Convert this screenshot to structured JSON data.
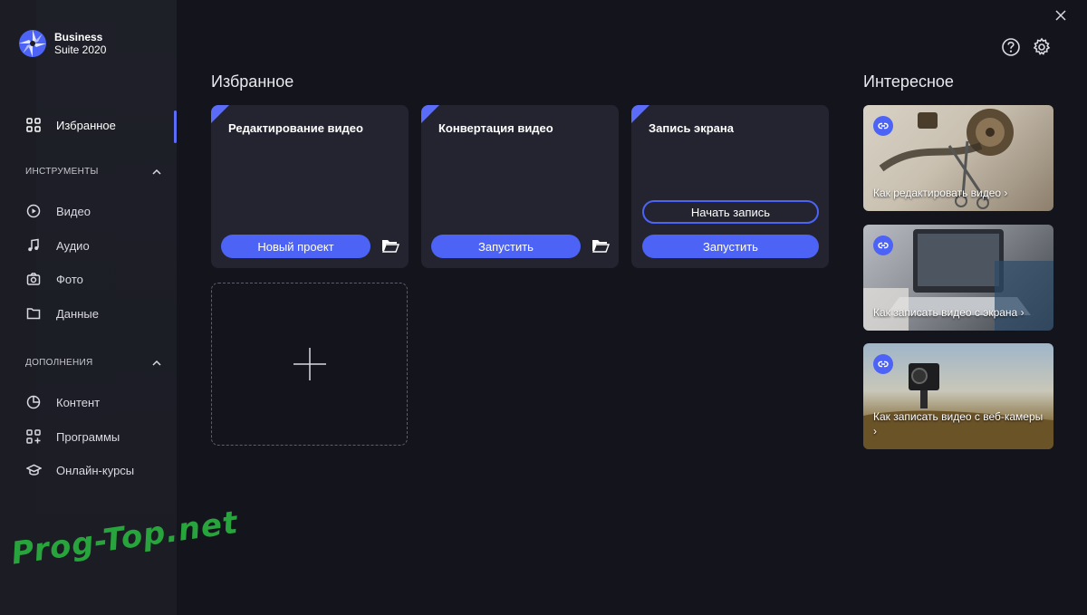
{
  "app": {
    "name_line1": "Business",
    "name_line2": "Suite 2020"
  },
  "colors": {
    "accent": "#4c63f6",
    "sidebar_bg": "#1b1c24",
    "main_bg": "#14151c",
    "card_bg": "#232430",
    "watermark": "#27a53c"
  },
  "sidebar": {
    "favorites": {
      "label": "Избранное",
      "icon": "grid-icon"
    },
    "tools_header": "ИНСТРУМЕНТЫ",
    "tools": [
      {
        "label": "Видео",
        "icon": "play-circle-icon"
      },
      {
        "label": "Аудио",
        "icon": "music-note-icon"
      },
      {
        "label": "Фото",
        "icon": "camera-icon"
      },
      {
        "label": "Данные",
        "icon": "folder-icon"
      }
    ],
    "addons_header": "ДОПОЛНЕНИЯ",
    "addons": [
      {
        "label": "Контент",
        "icon": "pie-chart-icon"
      },
      {
        "label": "Программы",
        "icon": "apps-plus-icon"
      },
      {
        "label": "Онлайн-курсы",
        "icon": "graduation-cap-icon"
      }
    ]
  },
  "favorites_section": {
    "title": "Избранное",
    "cards": [
      {
        "title": "Редактирование видео",
        "button": "Новый проект"
      },
      {
        "title": "Конвертация видео",
        "button": "Запустить"
      },
      {
        "title": "Запись экрана",
        "secondary_button": "Начать запись",
        "button": "Запустить"
      }
    ]
  },
  "interesting_section": {
    "title": "Интересное",
    "tiles": [
      {
        "caption": "Как редактировать видео ›"
      },
      {
        "caption": "Как записать видео с экрана ›"
      },
      {
        "caption": "Как записать видео с веб-камеры ›"
      }
    ]
  },
  "watermark": "Prog-Top.net"
}
